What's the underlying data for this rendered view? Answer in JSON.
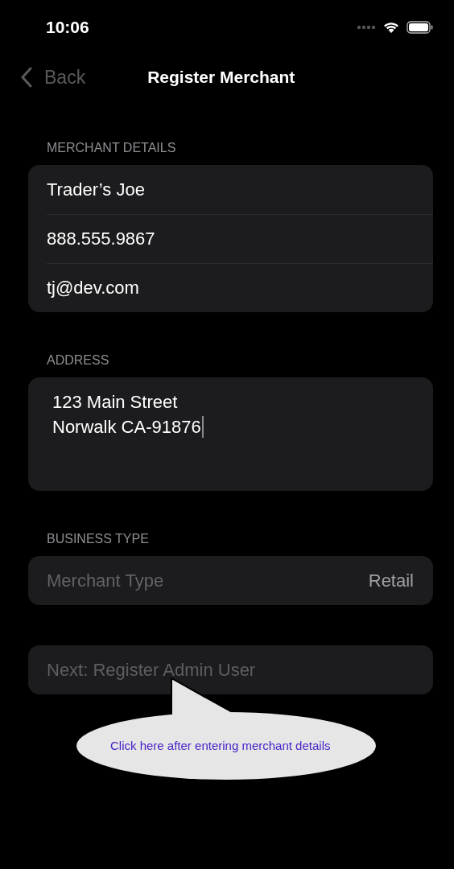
{
  "status_bar": {
    "time": "10:06"
  },
  "nav": {
    "back": "Back",
    "title": "Register Merchant"
  },
  "sections": [
    {
      "header": "MERCHANT DETAILS",
      "kind": "fields",
      "fields": [
        {
          "value": "Trader’s Joe"
        },
        {
          "value": "888.555.9867"
        },
        {
          "value": "tj@dev.com"
        }
      ]
    },
    {
      "header": "ADDRESS",
      "kind": "textarea",
      "lines": [
        "123 Main Street",
        "Norwalk CA-91876"
      ],
      "focused": true
    },
    {
      "header": "BUSINESS TYPE",
      "kind": "picker",
      "label": "Merchant Type",
      "value": "Retail"
    }
  ],
  "next_button": {
    "label": "Next: Register Admin User",
    "disabled": true
  },
  "callout": {
    "text": "Click here after entering merchant details"
  }
}
